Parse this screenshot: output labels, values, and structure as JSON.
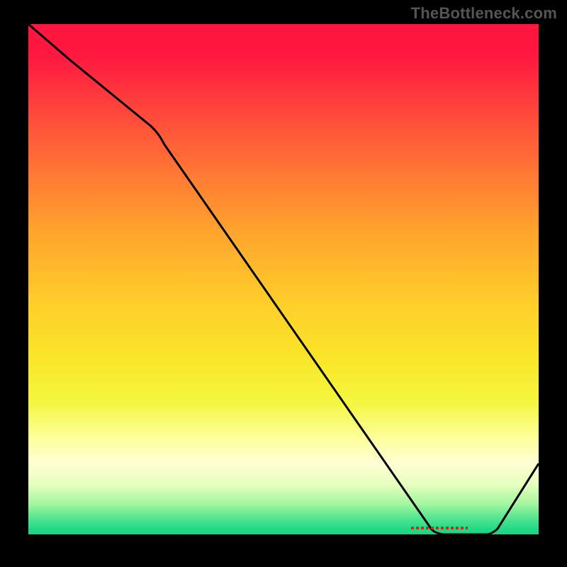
{
  "watermark": "TheBottleneck.com",
  "chart_data": {
    "type": "line",
    "title": "",
    "xlabel": "",
    "ylabel": "",
    "xlim": [
      0,
      100
    ],
    "ylim": [
      0,
      100
    ],
    "background": "red-yellow-green vertical gradient",
    "series": [
      {
        "name": "bottleneck-curve",
        "x": [
          0,
          8,
          24,
          26,
          79,
          82,
          86,
          90,
          100
        ],
        "values": [
          100,
          93,
          80,
          78,
          1,
          0,
          0,
          1,
          14
        ]
      }
    ],
    "annotations": [
      {
        "name": "optimal-marker",
        "text": "",
        "x": 85,
        "y": 0.5,
        "style": "small red dashed band"
      }
    ],
    "grid": false,
    "legend": false
  },
  "colors": {
    "curve_stroke": "#000000",
    "background_page": "#000000",
    "watermark_text": "#555555",
    "annotation_stroke": "#cc2b1f"
  }
}
